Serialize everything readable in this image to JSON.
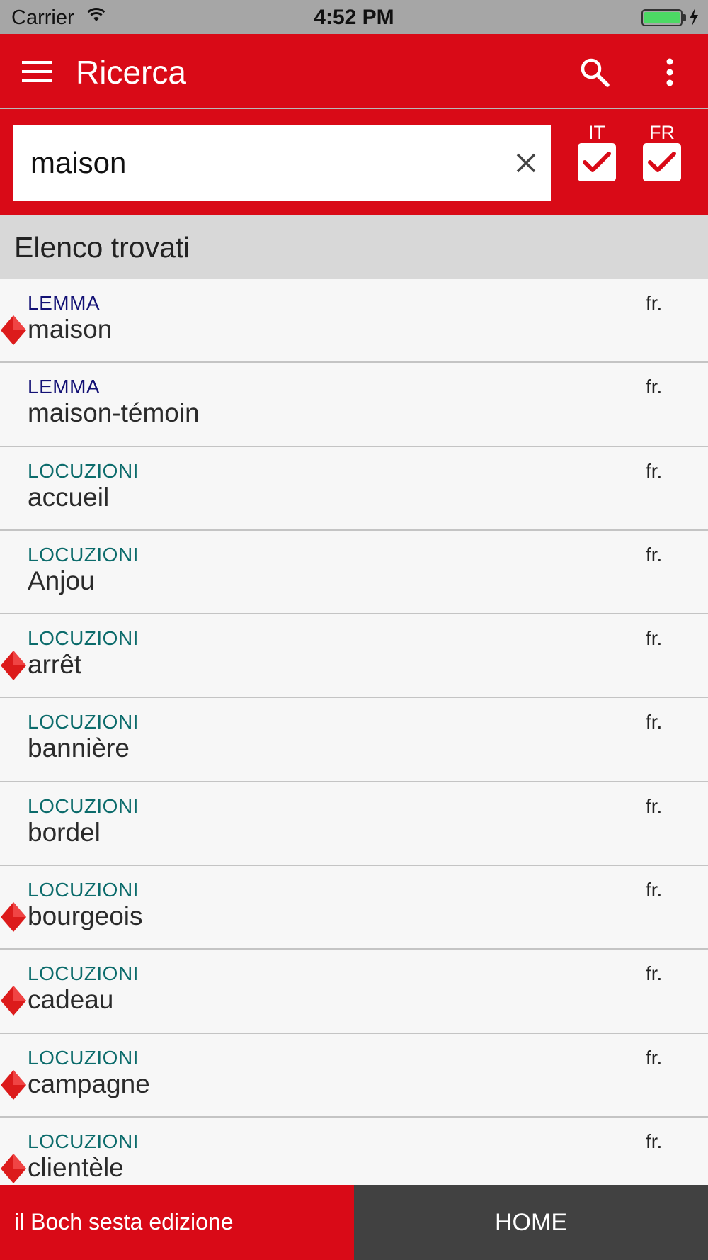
{
  "status_bar": {
    "carrier": "Carrier",
    "time": "4:52 PM"
  },
  "app_bar": {
    "title": "Ricerca"
  },
  "search": {
    "value": "maison",
    "languages": [
      {
        "code": "IT",
        "checked": true
      },
      {
        "code": "FR",
        "checked": true
      }
    ]
  },
  "results": {
    "header": "Elenco trovati",
    "items": [
      {
        "category": "LEMMA",
        "word": "maison",
        "lang": "fr.",
        "marked": true
      },
      {
        "category": "LEMMA",
        "word": "maison-témoin",
        "lang": "fr.",
        "marked": false
      },
      {
        "category": "LOCUZIONI",
        "word": "accueil",
        "lang": "fr.",
        "marked": false
      },
      {
        "category": "LOCUZIONI",
        "word": "Anjou",
        "lang": "fr.",
        "marked": false
      },
      {
        "category": "LOCUZIONI",
        "word": "arrêt",
        "lang": "fr.",
        "marked": true
      },
      {
        "category": "LOCUZIONI",
        "word": "bannière",
        "lang": "fr.",
        "marked": false
      },
      {
        "category": "LOCUZIONI",
        "word": "bordel",
        "lang": "fr.",
        "marked": false
      },
      {
        "category": "LOCUZIONI",
        "word": "bourgeois",
        "lang": "fr.",
        "marked": true
      },
      {
        "category": "LOCUZIONI",
        "word": "cadeau",
        "lang": "fr.",
        "marked": true
      },
      {
        "category": "LOCUZIONI",
        "word": "campagne",
        "lang": "fr.",
        "marked": true
      },
      {
        "category": "LOCUZIONI",
        "word": "clientèle",
        "lang": "fr.",
        "marked": true
      }
    ]
  },
  "bottom_bar": {
    "edition_label": "il Boch sesta edizione",
    "home_label": "HOME"
  },
  "colors": {
    "brand_red": "#d90a17",
    "lemma_color": "#131175",
    "locuzioni_color": "#0b6b6b",
    "home_bg": "#414141"
  },
  "icons": [
    "menu-icon",
    "search-icon",
    "more-vert-icon",
    "close-icon",
    "check-icon",
    "red-diamond-icon",
    "wifi-icon",
    "battery-icon"
  ]
}
